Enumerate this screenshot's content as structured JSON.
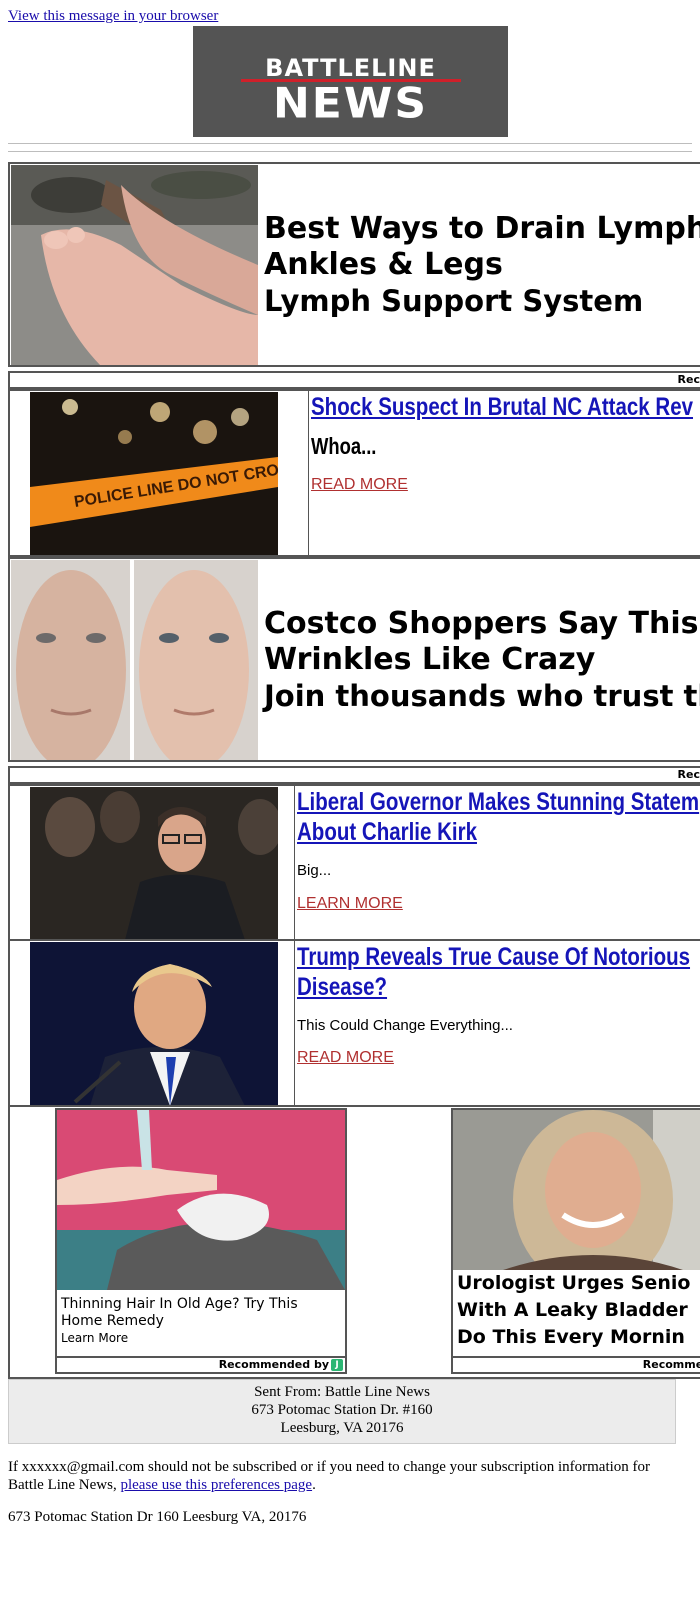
{
  "header": {
    "view_link": "View this message in your browser",
    "logo_line1": "BATTLELINE",
    "logo_line2": "NEWS",
    "logo_red": "#d0202a"
  },
  "ad1": {
    "headline1": "Best Ways to Drain Lymph Flu",
    "headline2": "Ankles & Legs",
    "subline": "Lymph Support System",
    "image": "swollen-feet-photo"
  },
  "rec_label": "Rec",
  "story1": {
    "title": "Shock Suspect In Brutal NC Attack Rev",
    "teaser": "Whoa...",
    "cta": "READ MORE",
    "image": "police-tape-photo"
  },
  "ad2": {
    "headline1": "Costco Shoppers Say This Re",
    "headline2": "Wrinkles Like Crazy",
    "subline": "Join thousands who trust this c",
    "image": "before-after-faces-photo"
  },
  "story2": {
    "title_line1": "Liberal Governor Makes Stunning Statem",
    "title_line2": "About Charlie Kirk",
    "teaser": "Big...",
    "cta": "LEARN MORE",
    "image": "governor-crowd-photo"
  },
  "story3": {
    "title_line1": "Trump Reveals True Cause Of Notorious",
    "title_line2": "Disease?",
    "teaser": "This Could Change Everything...",
    "cta": "READ MORE",
    "image": "trump-speaking-photo"
  },
  "grid": {
    "left": {
      "caption": "Thinning Hair In Old Age? Try This Home Remedy",
      "learn_more": "Learn More",
      "rec": "Recommended by",
      "image": "hair-remedy-illustration"
    },
    "right": {
      "caption1": "Urologist Urges Senio",
      "caption2": "With A Leaky Bladder",
      "caption3": "Do This Every Mornin",
      "rec": "Recommen",
      "image": "smiling-woman-photo"
    },
    "badge": "J"
  },
  "footer": {
    "line1": "Sent From: Battle Line News",
    "line2": "673 Potomac Station Dr. #160",
    "line3": "Leesburg, VA 20176",
    "unsub_text": "If xxxxxx@gmail.com should not be subscribed or if you need to change your subscription information for Battle Line News, ",
    "unsub_link": "please use this preferences page",
    "unsub_end": ".",
    "address": "673 Potomac Station Dr 160 Leesburg VA, 20176"
  }
}
